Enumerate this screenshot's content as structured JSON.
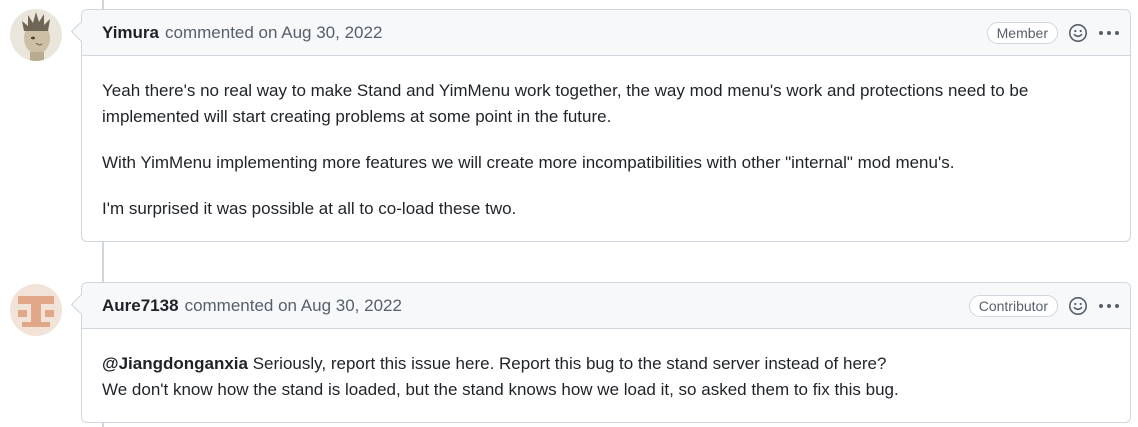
{
  "comments": [
    {
      "author": "Yimura",
      "action": "commented on Aug 30, 2022",
      "role_badge": "Member",
      "paragraphs": [
        "Yeah there's no real way to make Stand and YimMenu work together, the way mod menu's work and protections need to be implemented will start creating problems at some point in the future.",
        "With YimMenu implementing more features we will create more incompatibilities with other \"internal\" mod menu's.",
        "I'm surprised it was possible at all to co-load these two."
      ]
    },
    {
      "author": "Aure7138",
      "action": "commented on Aug 30, 2022",
      "role_badge": "Contributor",
      "mention": "@Jiangdonganxia",
      "line1_rest": " Seriously, report this issue here. Report this bug to the stand server instead of here?",
      "line2": "We don't know how the stand is loaded, but the stand knows how we load it, so asked them to fix this bug."
    }
  ],
  "icons": {
    "reaction": "smiley-icon",
    "menu": "kebab-horizontal-icon"
  },
  "colors": {
    "border": "#d0d7de",
    "header_bg": "#f6f8fa",
    "muted_text": "#57606a",
    "primary_text": "#1f2328"
  }
}
